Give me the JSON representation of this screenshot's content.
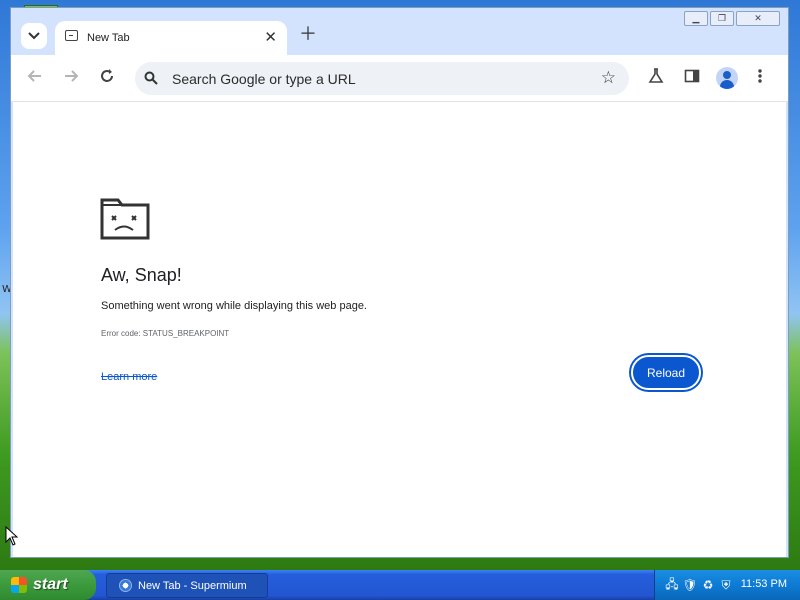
{
  "desktop": {
    "edge_label": "W"
  },
  "browser": {
    "tab": {
      "title": "New Tab"
    },
    "omnibox": {
      "placeholder": "Search Google or type a URL"
    },
    "toolbar_icons": [
      "back-icon",
      "forward-icon",
      "reload-icon",
      "labs-icon",
      "side-panel-icon",
      "profile-icon",
      "menu-icon"
    ]
  },
  "error_page": {
    "title": "Aw, Snap!",
    "message": "Something went wrong while displaying this web page.",
    "code": "Error code: STATUS_BREAKPOINT",
    "learn_more": "Learn more",
    "reload": "Reload"
  },
  "taskbar": {
    "start_label": "start",
    "task_item": "New Tab - Supermium",
    "clock": "11:53 PM"
  },
  "colors": {
    "accent": "#0b57d0",
    "tab_strip": "#d3e3fd",
    "taskbar": "#245edb",
    "start": "#3c9a3c"
  }
}
